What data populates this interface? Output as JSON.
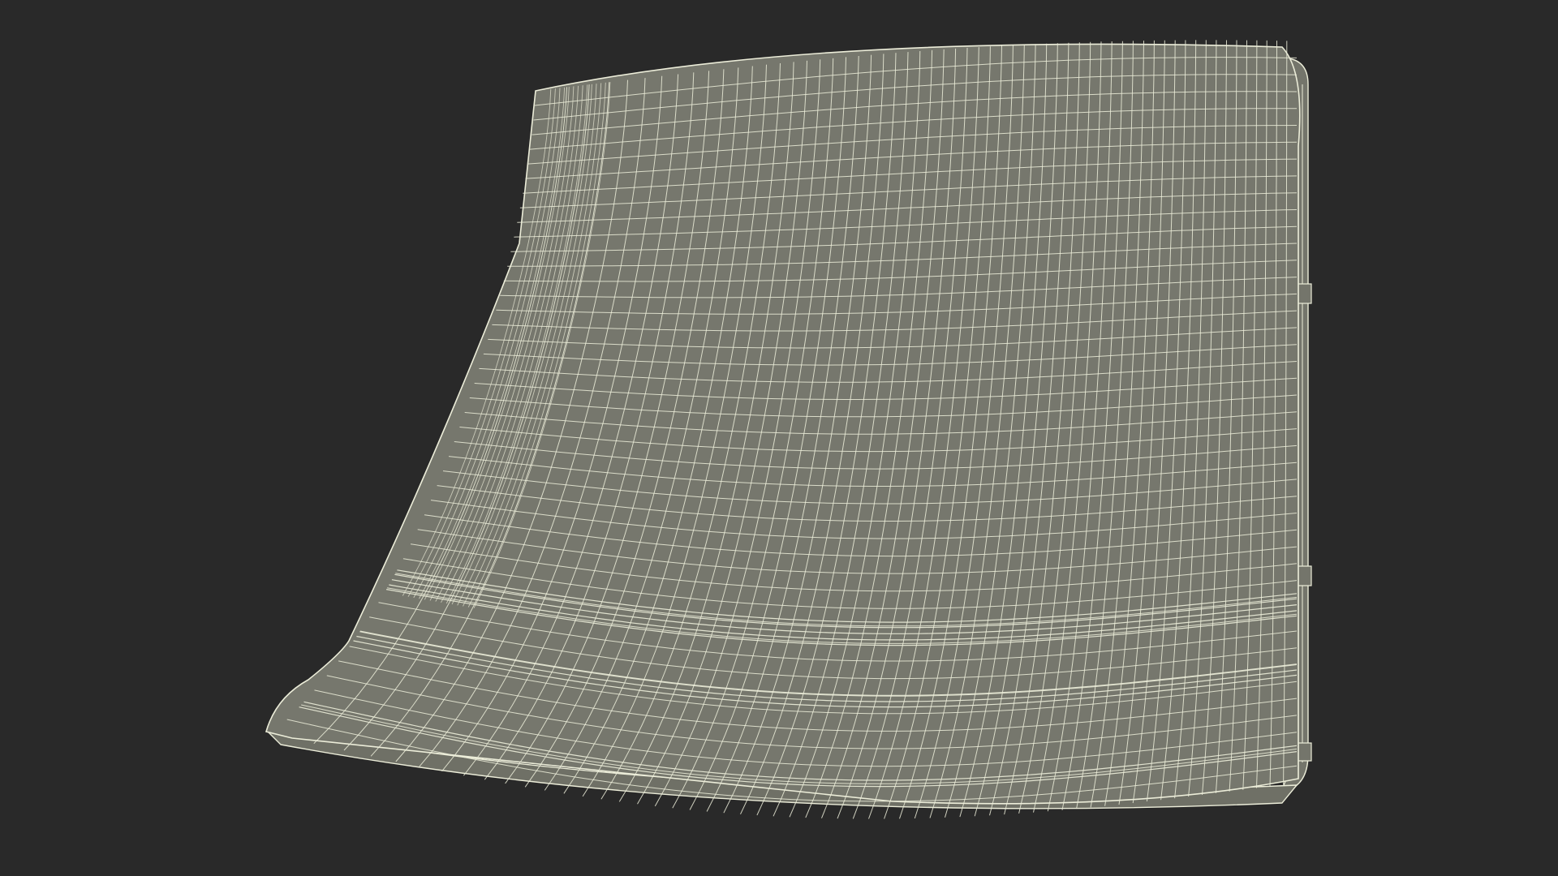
{
  "scene": {
    "background_color": "#292929",
    "mesh_fill_color": "#76776d",
    "mesh_edge_color": "#7f8076",
    "wire_color": "#ecedd9",
    "frame_color": "#74756b",
    "render_mode": "wireframe-on-shaded",
    "object": "cushioned-seat-with-metal-frame"
  }
}
